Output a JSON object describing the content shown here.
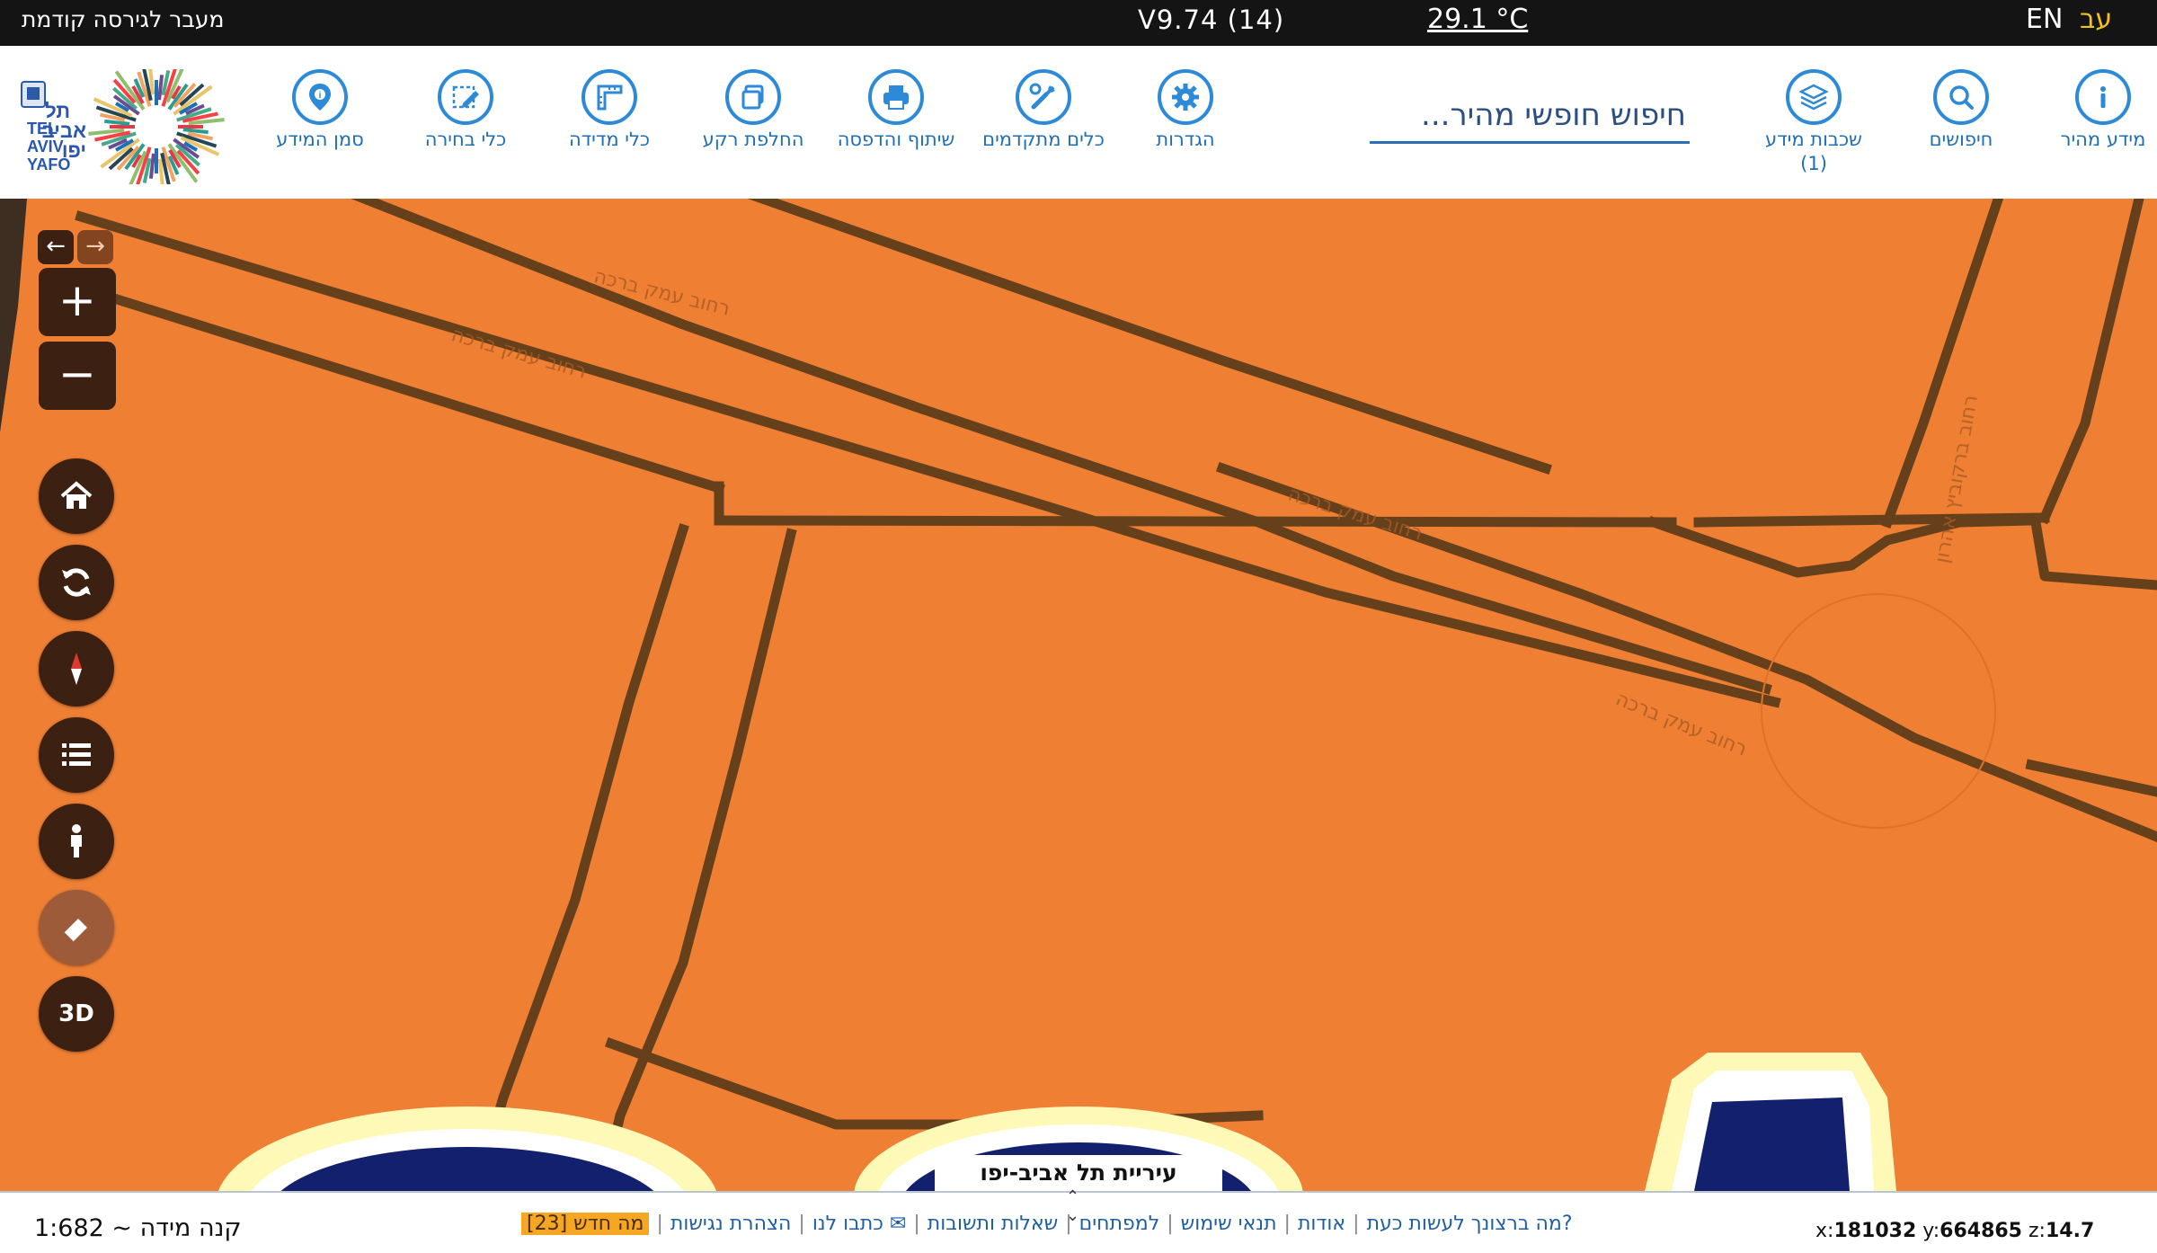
{
  "topbar": {
    "prev_version": "מעבר לגירסה קודמת",
    "version": "V9.74 (14)",
    "temperature": "29.1 °C",
    "lang_en": "EN",
    "lang_he": "עב"
  },
  "logo": {
    "text_he": "תל אביב יפו",
    "text_en": "TEL AVIV YAFO"
  },
  "toolbar": {
    "tools": [
      {
        "id": "info-marker",
        "label": "סמן המידע",
        "icon": "map-pin-info-icon"
      },
      {
        "id": "selection",
        "label": "כלי בחירה",
        "icon": "pencil-select-icon"
      },
      {
        "id": "measure",
        "label": "כלי מדידה",
        "icon": "ruler-icon"
      },
      {
        "id": "basemap",
        "label": "החלפת רקע",
        "icon": "layers-swap-icon"
      },
      {
        "id": "share-print",
        "label": "שיתוף והדפסה",
        "icon": "printer-icon"
      },
      {
        "id": "advanced-tools",
        "label": "כלים מתקדמים",
        "icon": "tools-icon"
      },
      {
        "id": "settings",
        "label": "הגדרות",
        "icon": "gear-icon"
      },
      {
        "id": "layers",
        "label": "שכבות מידע (1)",
        "icon": "layers-icon"
      },
      {
        "id": "searches",
        "label": "חיפושים",
        "icon": "search-icon"
      },
      {
        "id": "quick-info",
        "label": "מידע מהיר",
        "icon": "info-icon"
      }
    ],
    "search_placeholder": "חיפוש חופשי מהיר..."
  },
  "map": {
    "city_label": "עיריית תל אביב-יפו",
    "street_labels": [
      "רחוב עמק ברכה",
      "רחוב עמק ברכה",
      "רחוב עמק ברכה",
      "רחוב עמק ברכה",
      "רחוב ברקוביץ אהרון"
    ],
    "controls": [
      "arrow-left-icon",
      "arrow-right-icon",
      "zoom-in",
      "zoom-out",
      "home-icon",
      "refresh-icon",
      "compass-icon",
      "list-icon",
      "person-icon",
      "eraser-icon",
      "3D"
    ],
    "zoom_in": "+",
    "zoom_out": "−",
    "btn_3d": "3D",
    "colors": {
      "land": "#ee7f33",
      "road_edge": "#5a3b1a",
      "water": "#13206e",
      "halo": "#fff9b8"
    }
  },
  "bottombar": {
    "scale": "קנה מידה ~ 1:682",
    "links": [
      "מה ברצונך לעשות כעת?",
      "אודות",
      "תנאי שימוש",
      "למפתחים",
      "שאלות ותשובות",
      "כתבו לנו ✉",
      "הצהרת נגישות"
    ],
    "whats_new": "מה חדש [23]",
    "coords": {
      "x_label": "x:",
      "x": "181032",
      "y_label": "y:",
      "y": "664865",
      "z_label": "z:",
      "z": "14.7"
    }
  }
}
